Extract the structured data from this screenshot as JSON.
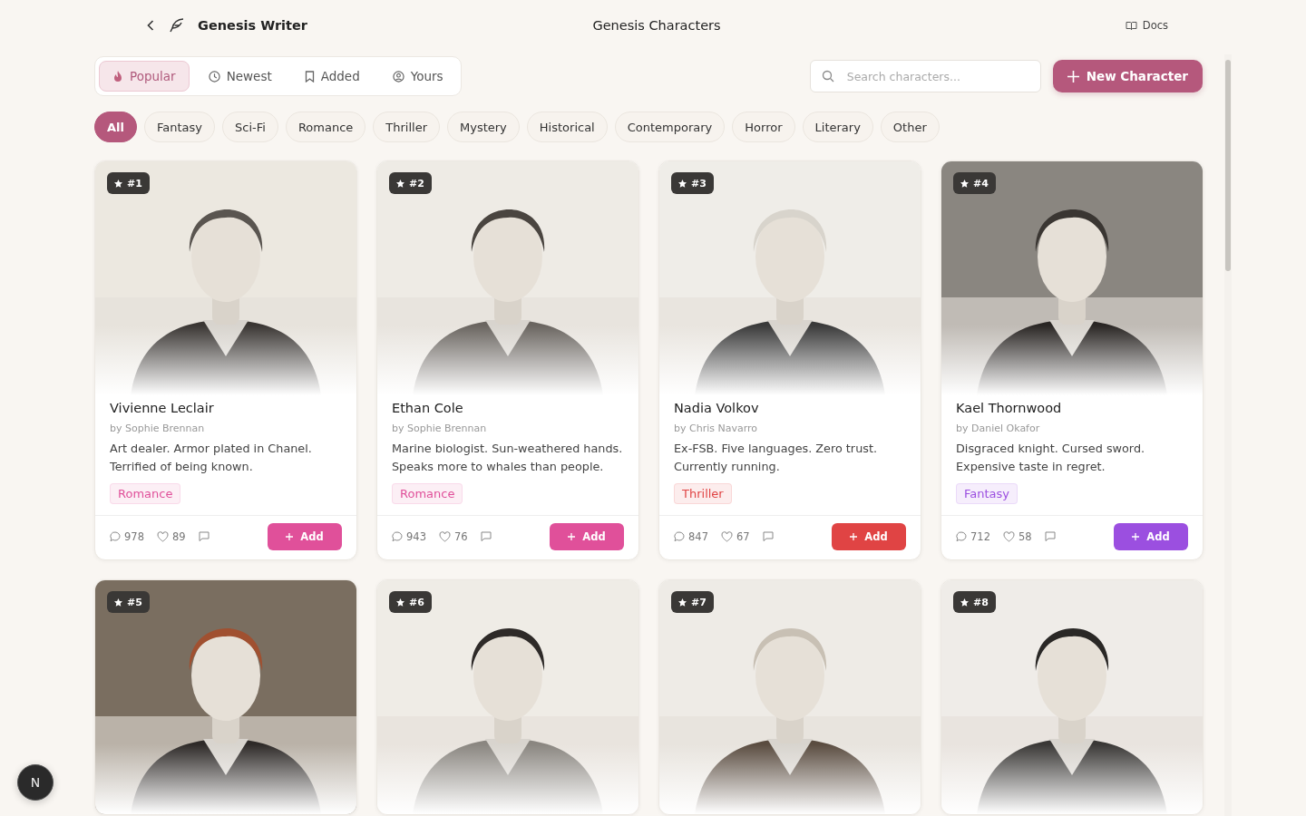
{
  "header": {
    "app_name": "Genesis Writer",
    "title": "Genesis Characters",
    "docs_link": "Docs"
  },
  "sort_tabs": [
    {
      "label": "Popular",
      "kind": "flame",
      "selected": true
    },
    {
      "label": "Newest",
      "kind": "clock",
      "selected": false
    },
    {
      "label": "Added",
      "kind": "bookmark",
      "selected": false
    },
    {
      "label": "Yours",
      "kind": "user",
      "selected": false
    }
  ],
  "search": {
    "placeholder": "Search characters..."
  },
  "new_button": "New Character",
  "genres": [
    {
      "label": "All",
      "selected": true
    },
    {
      "label": "Fantasy",
      "selected": false
    },
    {
      "label": "Sci-Fi",
      "selected": false
    },
    {
      "label": "Romance",
      "selected": false
    },
    {
      "label": "Thriller",
      "selected": false
    },
    {
      "label": "Mystery",
      "selected": false
    },
    {
      "label": "Historical",
      "selected": false
    },
    {
      "label": "Contemporary",
      "selected": false
    },
    {
      "label": "Horror",
      "selected": false
    },
    {
      "label": "Literary",
      "selected": false
    },
    {
      "label": "Other",
      "selected": false
    }
  ],
  "cards": [
    {
      "rank": "#1",
      "name": "Vivienne Leclair",
      "author": "by Sophie Brennan",
      "description": "Art dealer. Armor plated in Chanel. Terrified of being known.",
      "tag": "Romance",
      "color": "#e0509a",
      "comments": "978",
      "likes": "89",
      "add": "Add"
    },
    {
      "rank": "#2",
      "name": "Ethan Cole",
      "author": "by Sophie Brennan",
      "description": "Marine biologist. Sun-weathered hands. Speaks more to whales than people.",
      "tag": "Romance",
      "color": "#e0509a",
      "comments": "943",
      "likes": "76",
      "add": "Add"
    },
    {
      "rank": "#3",
      "name": "Nadia Volkov",
      "author": "by Chris Navarro",
      "description": "Ex-FSB. Five languages. Zero trust. Currently running.",
      "tag": "Thriller",
      "color": "#e04444",
      "comments": "847",
      "likes": "67",
      "add": "Add"
    },
    {
      "rank": "#4",
      "name": "Kael Thornwood",
      "author": "by Daniel Okafor",
      "description": "Disgraced knight. Cursed sword. Expensive taste in regret.",
      "tag": "Fantasy",
      "color": "#9b4fe0",
      "comments": "712",
      "likes": "58",
      "add": "Add"
    },
    {
      "rank": "#5"
    },
    {
      "rank": "#6"
    },
    {
      "rank": "#7"
    },
    {
      "rank": "#8"
    }
  ],
  "dev_badge": "N"
}
